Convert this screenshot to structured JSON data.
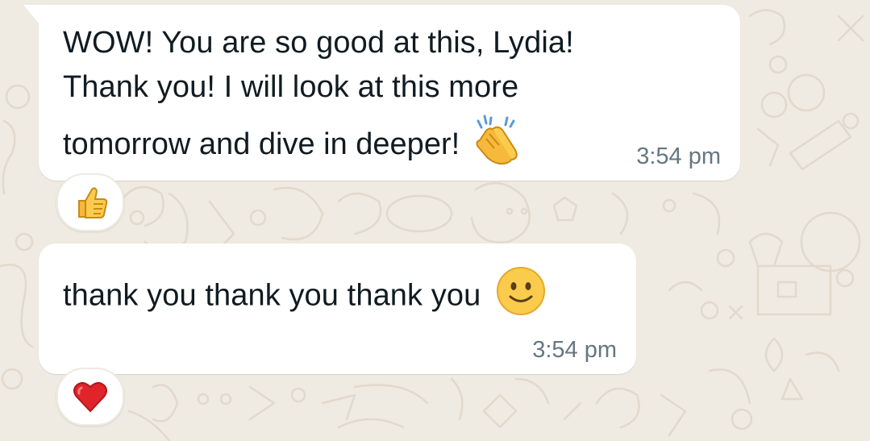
{
  "messages": [
    {
      "text": "WOW! You are so good at this, Lydia!\nThank you! I will look at this more",
      "text_line3": "tomorrow and dive in deeper!",
      "emoji": "clapping-hands-emoji",
      "time": "3:54 pm",
      "reaction": "thumbs-up-emoji"
    },
    {
      "text": "thank you thank you thank you",
      "emoji": "slightly-smiling-face-emoji",
      "time": "3:54 pm",
      "reaction": "red-heart-emoji"
    }
  ],
  "colors": {
    "wallpaper": "#efeae2",
    "bubble": "#ffffff",
    "text": "#111b21",
    "timestamp": "#667781"
  }
}
